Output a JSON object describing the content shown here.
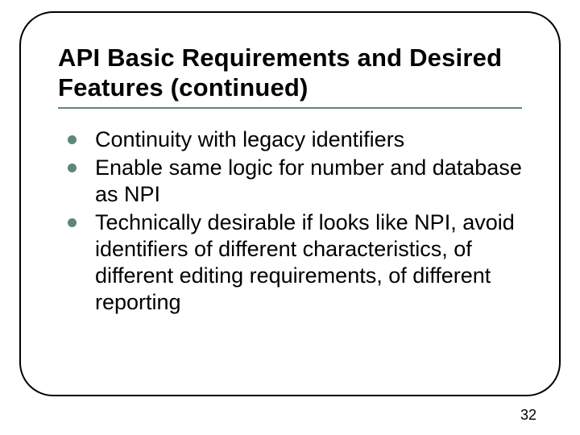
{
  "slide": {
    "title": "API Basic Requirements and Desired Features (continued)",
    "bullets": [
      "Continuity with legacy identifiers",
      "Enable same logic for number and database as NPI",
      "Technically desirable if looks like NPI, avoid identifiers of different characteristics, of different editing requirements, of different reporting"
    ],
    "page_number": "32",
    "accent_color": "#5d867d"
  }
}
